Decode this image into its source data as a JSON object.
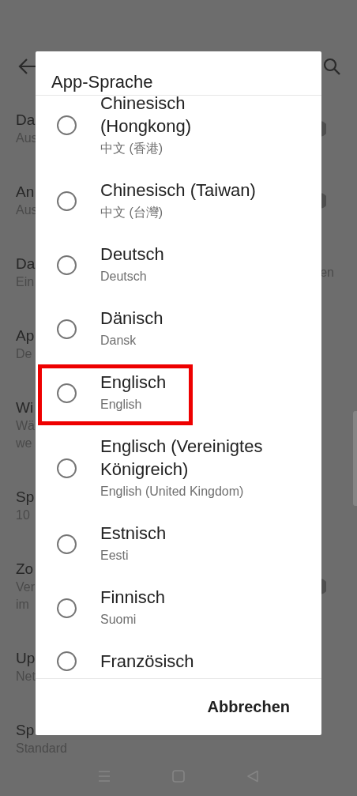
{
  "settings": [
    {
      "title": "Da",
      "subtitle": [
        "Aus"
      ],
      "kind": "switch"
    },
    {
      "title": "An",
      "subtitle": [
        "Aus"
      ],
      "kind": "switch"
    },
    {
      "title": "Da",
      "subtitle": [
        "Ein"
      ],
      "kind": "text",
      "trailing": "en"
    },
    {
      "title": "Ap",
      "subtitle": [
        "De"
      ],
      "kind": "plain"
    },
    {
      "title": "Wi",
      "subtitle": [
        "Wä",
        "we"
      ],
      "kind": "plain"
    },
    {
      "title": "Sp",
      "subtitle": [
        "10"
      ],
      "kind": "plain"
    },
    {
      "title": "Zo",
      "subtitle": [
        "Ver",
        "im"
      ],
      "kind": "switch"
    },
    {
      "title": "Up",
      "subtitle": [
        "Net"
      ],
      "kind": "plain"
    },
    {
      "title": "Sp",
      "subtitle": [
        "Standard"
      ],
      "kind": "plain"
    }
  ],
  "dialog": {
    "title": "App-Sprache",
    "options": [
      {
        "name": "Chinesisch (Hongkong)",
        "native": "中文 (香港)",
        "selected": false,
        "highlighted": false
      },
      {
        "name": "Chinesisch (Taiwan)",
        "native": "中文 (台灣)",
        "selected": false,
        "highlighted": false
      },
      {
        "name": "Deutsch",
        "native": "Deutsch",
        "selected": false,
        "highlighted": false
      },
      {
        "name": "Dänisch",
        "native": "Dansk",
        "selected": false,
        "highlighted": false
      },
      {
        "name": "Englisch",
        "native": "English",
        "selected": false,
        "highlighted": true
      },
      {
        "name": "Englisch (Vereinigtes Königreich)",
        "native": "English (United Kingdom)",
        "selected": false,
        "highlighted": false
      },
      {
        "name": "Estnisch",
        "native": "Eesti",
        "selected": false,
        "highlighted": false
      },
      {
        "name": "Finnisch",
        "native": "Suomi",
        "selected": false,
        "highlighted": false
      },
      {
        "name": "Französisch",
        "selected": false,
        "highlighted": false
      }
    ],
    "cancel": "Abbrechen"
  }
}
